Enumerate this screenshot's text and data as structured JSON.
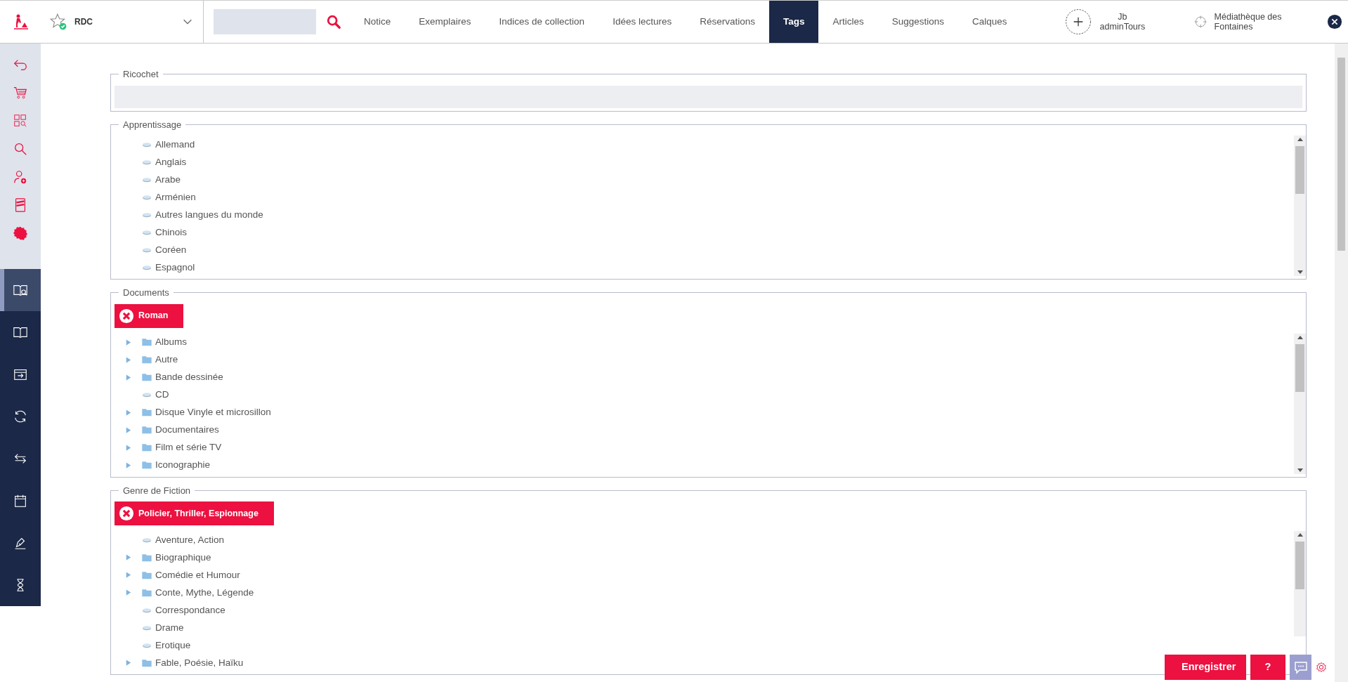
{
  "header": {
    "floor": "RDC"
  },
  "tabs": [
    {
      "label": "Notice",
      "selected": false
    },
    {
      "label": "Exemplaires",
      "selected": false
    },
    {
      "label": "Indices de collection",
      "selected": false
    },
    {
      "label": "Idées lectures",
      "selected": false
    },
    {
      "label": "Réservations",
      "selected": false
    },
    {
      "label": "Tags",
      "selected": true
    },
    {
      "label": "Articles",
      "selected": false
    },
    {
      "label": "Suggestions",
      "selected": false
    },
    {
      "label": "Calques",
      "selected": false
    }
  ],
  "user": {
    "name": "Jb",
    "login": "adminTours"
  },
  "library": {
    "name": "Médiathèque des Fontaines"
  },
  "sidebar": {
    "nav": [
      {
        "selected": true
      },
      {
        "selected": false
      },
      {
        "selected": false
      },
      {
        "selected": false
      },
      {
        "selected": false
      },
      {
        "selected": false
      },
      {
        "selected": false
      },
      {
        "selected": false
      }
    ]
  },
  "sections": [
    {
      "legend": "Ricochet",
      "kind": "bar"
    },
    {
      "legend": "Apprentissage",
      "kind": "tree",
      "items": [
        {
          "label": "Allemand",
          "kind": "leaf"
        },
        {
          "label": "Anglais",
          "kind": "leaf"
        },
        {
          "label": "Arabe",
          "kind": "leaf"
        },
        {
          "label": "Arménien",
          "kind": "leaf"
        },
        {
          "label": "Autres langues du monde",
          "kind": "leaf"
        },
        {
          "label": "Chinois",
          "kind": "leaf"
        },
        {
          "label": "Coréen",
          "kind": "leaf"
        },
        {
          "label": "Espagnol",
          "kind": "leaf"
        }
      ]
    },
    {
      "legend": "Documents",
      "kind": "tree",
      "filters": [
        {
          "label": "Roman"
        }
      ],
      "items": [
        {
          "label": "Albums",
          "kind": "folder",
          "expanded": false
        },
        {
          "label": "Autre",
          "kind": "folder",
          "expanded": false
        },
        {
          "label": "Bande dessinée",
          "kind": "folder",
          "expanded": false
        },
        {
          "label": "CD",
          "kind": "leaf"
        },
        {
          "label": "Disque Vinyle et microsillon",
          "kind": "folder",
          "expanded": false
        },
        {
          "label": "Documentaires",
          "kind": "folder",
          "expanded": false
        },
        {
          "label": "Film et série TV",
          "kind": "folder",
          "expanded": false
        },
        {
          "label": "Iconographie",
          "kind": "folder",
          "expanded": false
        }
      ]
    },
    {
      "legend": "Genre de Fiction",
      "kind": "tree",
      "filters": [
        {
          "label": "Policier, Thriller, Espionnage"
        }
      ],
      "items": [
        {
          "label": "Aventure, Action",
          "kind": "leaf"
        },
        {
          "label": "Biographique",
          "kind": "folder",
          "expanded": false
        },
        {
          "label": "Comédie et Humour",
          "kind": "folder",
          "expanded": false
        },
        {
          "label": "Conte, Mythe, Légende",
          "kind": "folder",
          "expanded": false
        },
        {
          "label": "Correspondance",
          "kind": "leaf"
        },
        {
          "label": "Drame",
          "kind": "leaf"
        },
        {
          "label": "Erotique",
          "kind": "leaf"
        },
        {
          "label": "Fable, Poésie, Haïku",
          "kind": "folder",
          "expanded": false
        }
      ]
    }
  ],
  "actions": {
    "save": "Enregistrer",
    "help": "?"
  }
}
